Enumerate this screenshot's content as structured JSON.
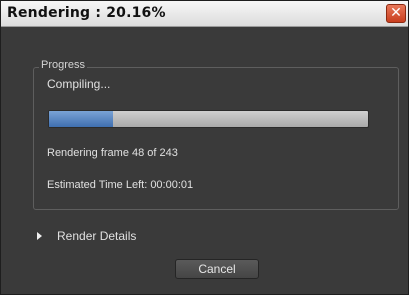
{
  "window": {
    "title": "Rendering : 20.16%",
    "close_glyph": "✕"
  },
  "progress_group": {
    "label": "Progress",
    "status": "Compiling...",
    "progress_fraction": 0.2016,
    "frame_text": "Rendering frame 48 of 243",
    "time_left_text": "Estimated Time Left: 00:00:01"
  },
  "details": {
    "label": "Render Details",
    "icon": "triangle-right-icon"
  },
  "buttons": {
    "cancel_label": "Cancel"
  },
  "colors": {
    "accent_progress": "#4f7fc0",
    "panel_bg": "#3a3a3a",
    "close_button": "#d4502e"
  }
}
